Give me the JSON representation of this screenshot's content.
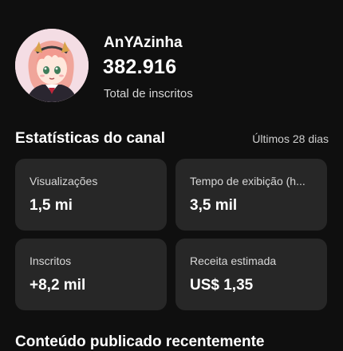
{
  "channel": {
    "name": "AnYAzinha",
    "subscribers": "382.916",
    "subscribers_label": "Total de inscritos",
    "avatar_icon": "anime-girl-avatar-icon"
  },
  "stats": {
    "title": "Estatísticas do canal",
    "period": "Últimos 28 dias",
    "cards": [
      {
        "label": "Visualizações",
        "value": "1,5 mi"
      },
      {
        "label": "Tempo de exibição (h...",
        "value": "3,5 mil"
      },
      {
        "label": "Inscritos",
        "value": "+8,2 mil"
      },
      {
        "label": "Receita estimada",
        "value": "US$ 1,35"
      }
    ]
  },
  "next_section": {
    "title": "Conteúdo publicado recentemente"
  },
  "colors": {
    "background": "#0f0f0f",
    "card": "#272727",
    "text_secondary": "#d6d6d6"
  }
}
